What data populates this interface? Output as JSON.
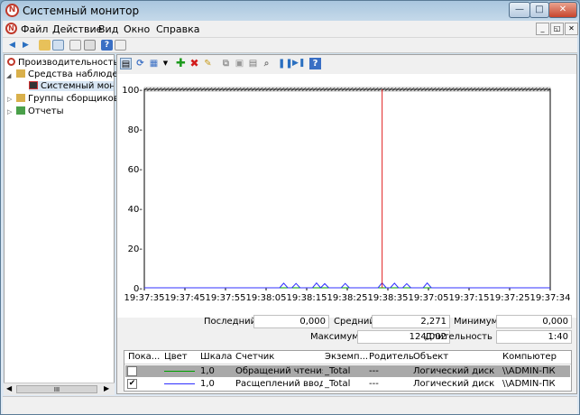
{
  "window": {
    "title": "Системный монитор",
    "btn_min": "—",
    "btn_max": "□",
    "btn_close": "✕"
  },
  "menu": [
    "Файл",
    "Действие",
    "Вид",
    "Окно",
    "Справка"
  ],
  "mdi_buttons": [
    "_",
    "◱",
    "✕"
  ],
  "tree": {
    "root": "Производительность",
    "monitoring": "Средства наблюдени",
    "sysmon": "Системный мони",
    "groups": "Группы сборщиков ,",
    "reports": "Отчеты"
  },
  "hscroll_mark": "III",
  "chart": {
    "y_ticks": [
      "100-",
      "80-",
      "60-",
      "40-",
      "20-",
      "0-"
    ],
    "x_ticks": [
      "19:37:35",
      "19:37:45",
      "19:37:55",
      "19:38:05",
      "19:38:15",
      "19:38:25",
      "19:38:35",
      "19:37:05",
      "19:37:15",
      "19:37:25",
      "19:37:34"
    ],
    "ylim": [
      0,
      100
    ]
  },
  "chart_data": {
    "type": "line",
    "ylim": [
      0,
      100
    ],
    "x": [
      "19:37:35",
      "19:37:45",
      "19:37:55",
      "19:38:05",
      "19:38:15",
      "19:38:25",
      "19:38:35",
      "19:37:05",
      "19:37:15",
      "19:37:25",
      "19:37:34"
    ],
    "series": [
      {
        "name": "Обращений чтения",
        "color": "#00a000",
        "values": [
          0,
          0,
          0,
          0,
          0,
          0,
          0,
          0,
          0,
          0,
          0,
          0,
          0,
          0,
          0,
          0,
          0,
          0,
          0,
          0,
          0,
          0,
          0,
          0,
          0,
          0,
          0,
          0,
          0,
          0,
          0,
          0,
          0,
          0,
          0,
          0,
          0,
          0,
          0,
          0,
          0,
          0,
          0,
          0,
          0,
          0,
          0,
          0,
          0,
          0,
          0,
          0,
          0,
          0,
          0,
          0,
          0,
          0,
          0,
          0,
          0,
          0,
          0,
          0,
          0,
          0,
          0,
          0,
          0,
          0,
          0,
          0,
          0,
          0,
          0,
          0,
          0,
          0,
          0,
          0,
          0,
          0,
          0,
          0,
          0,
          0,
          0,
          0,
          0,
          0,
          0,
          0,
          0,
          0,
          0,
          0,
          0,
          0,
          0,
          0
        ]
      },
      {
        "name": "Расщеплений ввод",
        "color": "#3030ff",
        "values": [
          0,
          0,
          0,
          0,
          0,
          0,
          0,
          0,
          0,
          0,
          0,
          0,
          0,
          0,
          0,
          0,
          0,
          0,
          0,
          0,
          0,
          0,
          0,
          0,
          0,
          0,
          0,
          0,
          0,
          0,
          0,
          0,
          0,
          0,
          2.3,
          0,
          0,
          2.2,
          0,
          0,
          0,
          0,
          2.4,
          0,
          2.1,
          0,
          0,
          0,
          0,
          2.2,
          0,
          0,
          0,
          0,
          0,
          0,
          0,
          0,
          2.5,
          0,
          0,
          2.3,
          0,
          0,
          2.1,
          0,
          0,
          0,
          0,
          2.4,
          0,
          0,
          0,
          0,
          0,
          0,
          0,
          0,
          0,
          0,
          0,
          0,
          0,
          0,
          0,
          0,
          0,
          0,
          0,
          0,
          0,
          0,
          0,
          0,
          0,
          0,
          0,
          0,
          0,
          0
        ]
      }
    ],
    "current_marker_index": 58
  },
  "stats": {
    "last_label": "Последний",
    "last_value": "0,000",
    "avg_label": "Средний",
    "avg_value": "2,271",
    "min_label": "Минимум",
    "min_value": "0,000",
    "max_label": "Максимум",
    "max_value": "124,002",
    "dur_label": "Длительность",
    "dur_value": "1:40"
  },
  "legend": {
    "headers": [
      "Пока...",
      "Цвет",
      "Шкала",
      "Счетчик",
      "Экземп...",
      "Родитель",
      "Объект",
      "Компьютер"
    ],
    "rows": [
      {
        "show": "",
        "color": "#00a000",
        "scale": "1,0",
        "counter": "Обращений чтения...",
        "instance": "_Total",
        "parent": "---",
        "object": "Логический диск",
        "computer": "\\\\ADMIN-ПК"
      },
      {
        "show": "✔",
        "color": "#3030ff",
        "scale": "1,0",
        "counter": "Расщеплений ввод...",
        "instance": "_Total",
        "parent": "---",
        "object": "Логический диск",
        "computer": "\\\\ADMIN-ПК"
      }
    ]
  }
}
